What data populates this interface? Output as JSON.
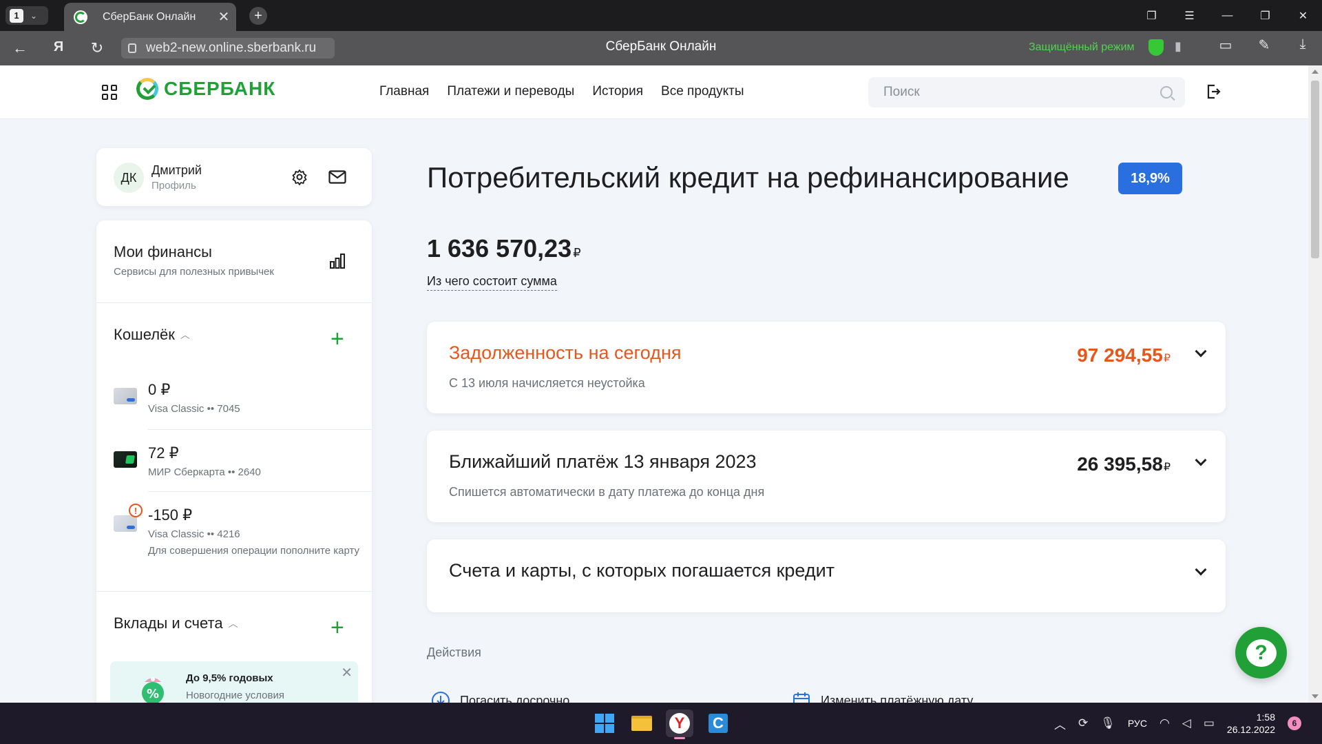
{
  "browser": {
    "tab_count": "1",
    "tab_title": "СберБанк Онлайн",
    "tab_close": "✕",
    "new_tab": "+",
    "url": "web2-new.online.sberbank.ru",
    "page_title": "СберБанк Онлайн",
    "secure_mode": "Защищённый режим"
  },
  "header": {
    "logo_text": "СБЕРБАНК",
    "nav": [
      "Главная",
      "Платежи и переводы",
      "История",
      "Все продукты"
    ],
    "search_placeholder": "Поиск"
  },
  "profile": {
    "initials": "ДК",
    "name": "Дмитрий",
    "subtitle": "Профиль"
  },
  "sidebar": {
    "finances_title": "Мои финансы",
    "finances_subtitle": "Сервисы для полезных привычек",
    "wallet_title": "Кошелёк",
    "cards": [
      {
        "amount": "0 ₽",
        "name": "Visa Classic •• 7045"
      },
      {
        "amount": "72 ₽",
        "name": "МИР Сберкарта •• 2640"
      },
      {
        "amount": "-150 ₽",
        "name": "Visa Classic •• 4216",
        "note": "Для совершения операции пополните карту",
        "warning": "!"
      }
    ],
    "deposits_title": "Вклады и счета",
    "promo": {
      "title": "До 9,5% годовых",
      "subtitle": "Новогодние условия",
      "close": "✕"
    }
  },
  "loan": {
    "title": "Потребительский кредит на рефинансирование",
    "rate": "18,9%",
    "total_amount": "1 636 570,23",
    "currency": "₽",
    "breakdown_link": "Из чего состоит сумма",
    "debt": {
      "title": "Задолженность на сегодня",
      "subtitle": "С 13 июля начисляется неустойка",
      "amount": "97 294,55"
    },
    "next_payment": {
      "title": "Ближайший платёж 13 января 2023",
      "subtitle": "Спишется автоматически в дату платежа до конца дня",
      "amount": "26 395,58"
    },
    "accounts": {
      "title": "Счета и карты, с которых погашается кредит"
    },
    "actions_label": "Действия",
    "actions": [
      "Погасить досрочно",
      "Изменить платёжную дату"
    ]
  },
  "help": {
    "label": "?"
  },
  "taskbar": {
    "yandex": "Y",
    "c_app": "C",
    "language": "РУС",
    "time": "1:58",
    "date": "26.12.2022",
    "notifications": "6"
  },
  "colors": {
    "brand_green": "#21a038",
    "debt_orange": "#e5571c",
    "rate_blue": "#2a6fe0"
  }
}
